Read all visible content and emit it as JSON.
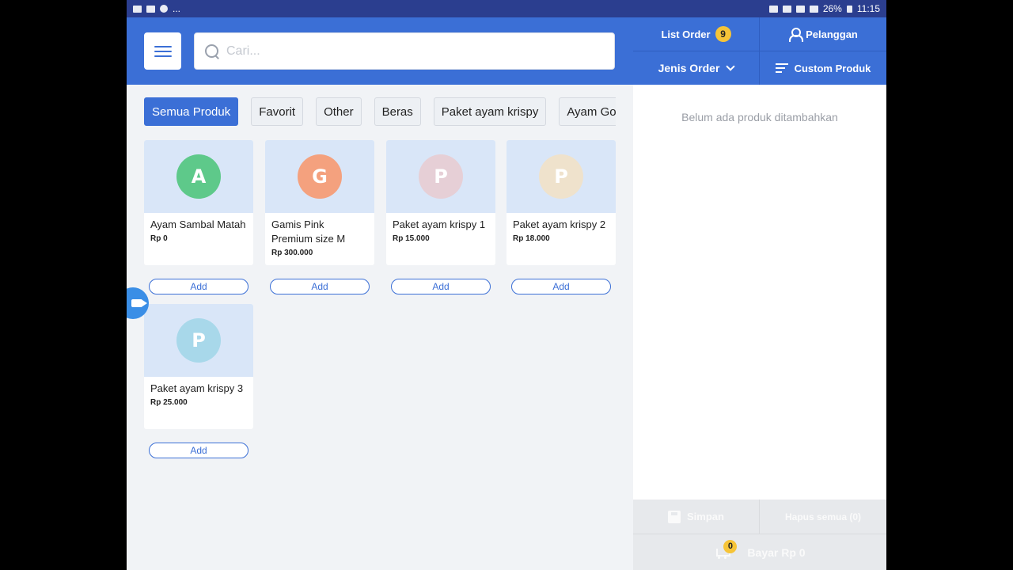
{
  "statusbar": {
    "left_text": "...",
    "battery": "26%",
    "time": "11:15"
  },
  "search": {
    "placeholder": "Cari..."
  },
  "right_header": {
    "list_order_label": "List Order",
    "list_order_count": "9",
    "customer_label": "Pelanggan",
    "order_type_label": "Jenis Order",
    "custom_product_label": "Custom Produk"
  },
  "categories": [
    {
      "label": "Semua Produk",
      "active": true
    },
    {
      "label": "Favorit"
    },
    {
      "label": "Other"
    },
    {
      "label": "Beras"
    },
    {
      "label": "Paket ayam krispy"
    },
    {
      "label": "Ayam Goreng"
    }
  ],
  "products": [
    {
      "initial": "A",
      "name": "Ayam Sambal Matah",
      "price": "Rp 0",
      "color": "#5ec98a"
    },
    {
      "initial": "G",
      "name": "Gamis Pink Premium size M",
      "price": "Rp 300.000",
      "color": "#f4a17e"
    },
    {
      "initial": "P",
      "name": "Paket ayam krispy 1",
      "price": "Rp 15.000",
      "color": "#e6cfd6"
    },
    {
      "initial": "P",
      "name": "Paket ayam krispy 2",
      "price": "Rp 18.000",
      "color": "#efe2cc"
    },
    {
      "initial": "P",
      "name": "Paket ayam krispy 3",
      "price": "Rp 25.000",
      "color": "#a8d8ea"
    }
  ],
  "add_label": "Add",
  "cart": {
    "empty_text": "Belum ada produk ditambahkan",
    "save_label": "Simpan",
    "clear_label": "Hapus semua (0)",
    "pay_label": "Bayar Rp 0",
    "cart_count": "0"
  },
  "colors": {
    "primary": "#3b6fd6",
    "badge": "#f6c438"
  }
}
